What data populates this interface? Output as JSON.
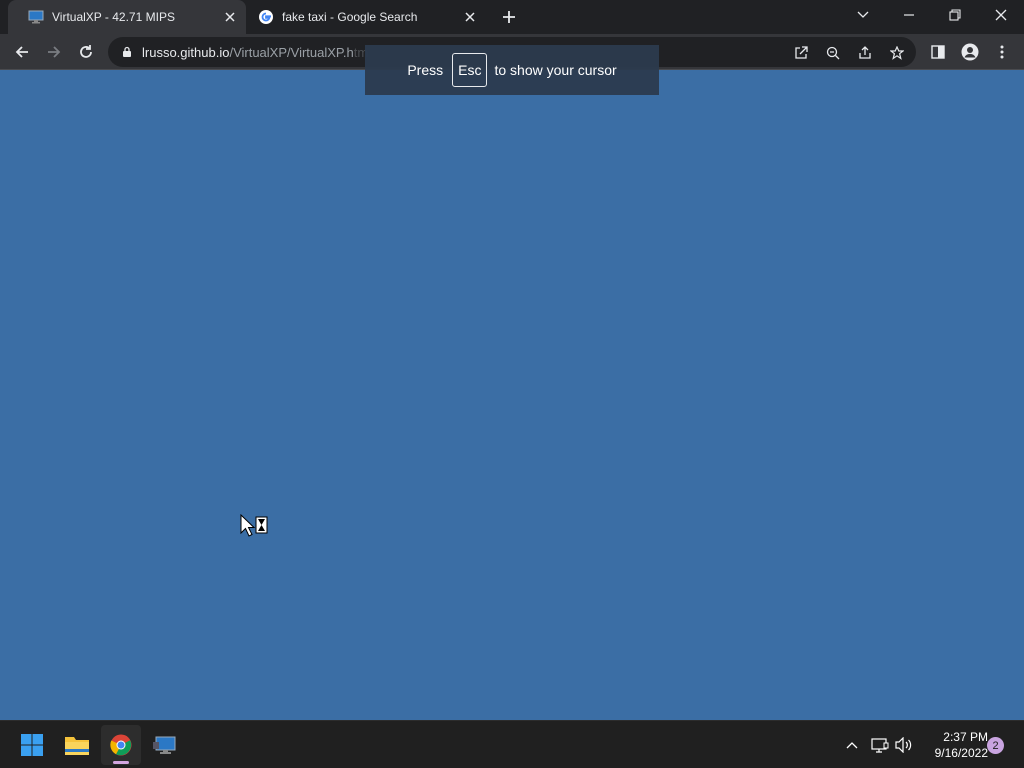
{
  "browser": {
    "tabs": [
      {
        "title": "VirtualXP - 42.71 MIPS",
        "active": true,
        "favicon": "monitor-icon"
      },
      {
        "title": "fake taxi - Google Search",
        "active": false,
        "favicon": "google-g-icon"
      }
    ],
    "omnibox": {
      "url_host": "lrusso.github.io",
      "url_path": "/VirtualXP/VirtualXP.h",
      "url_fade": "tm"
    }
  },
  "banner": {
    "prefix": "Press",
    "key": "Esc",
    "suffix": "to show your cursor"
  },
  "taskbar": {
    "apps": [
      "start-icon",
      "file-explorer-icon",
      "chrome-icon",
      "virtualxp-icon"
    ],
    "clock": {
      "time": "2:37 PM",
      "date": "9/16/2022"
    },
    "notifications": "2"
  },
  "colors": {
    "desktop": "#3b6ea5",
    "tabstrip": "#202124",
    "toolbar": "#35363a",
    "taskbar": "#202020"
  }
}
